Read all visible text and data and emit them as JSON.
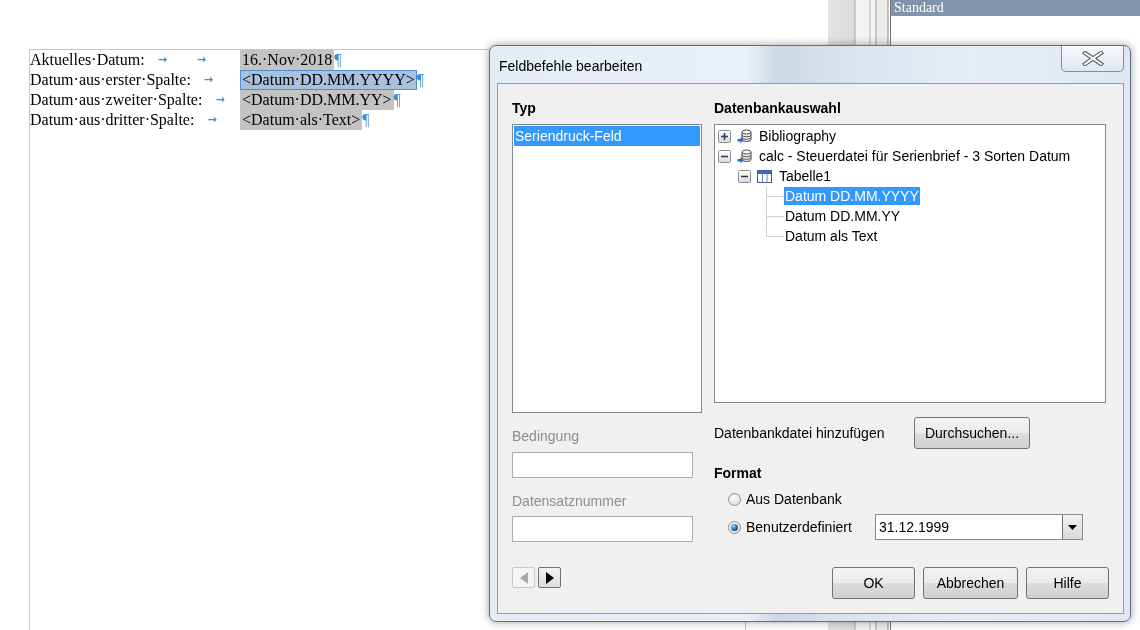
{
  "document": {
    "lines": [
      {
        "label": "Aktuelles·Datum:",
        "tab_marks": [
          "→",
          "→"
        ],
        "field": "16.·Nov·2018",
        "selected": false,
        "paragraph_mark": "¶"
      },
      {
        "label": "Datum·aus·erster·Spalte:",
        "tab_marks": [
          "→"
        ],
        "field": "<Datum·DD.MM.YYYY>",
        "selected": true,
        "paragraph_mark": "¶"
      },
      {
        "label": "Datum·aus·zweiter·Spalte:",
        "tab_marks": [
          "→"
        ],
        "field": "<Datum·DD.MM.YY>",
        "selected": false,
        "paragraph_mark": "¶"
      },
      {
        "label": "Datum·aus·dritter·Spalte:",
        "tab_marks": [
          "→"
        ],
        "field": "<Datum·als·Text>",
        "selected": false,
        "paragraph_mark": "¶"
      }
    ]
  },
  "sidebar": {
    "header": "Standard"
  },
  "dialog": {
    "title": "Feldbefehle bearbeiten",
    "type": {
      "heading": "Typ",
      "items": [
        {
          "label": "Seriendruck-Feld",
          "selected": true
        }
      ]
    },
    "condition": {
      "label": "Bedingung",
      "disabled": true
    },
    "record_number": {
      "label": "Datensatznummer",
      "disabled": true
    },
    "record_nav": [
      {
        "kind": "previous",
        "disabled": true
      },
      {
        "kind": "next",
        "disabled": false
      }
    ],
    "database_selection": {
      "heading": "Datenbankauswahl",
      "tree": [
        {
          "label": "Bibliography",
          "kind": "database",
          "expanded": false,
          "selected": false
        },
        {
          "label": "calc - Steuerdatei für Serienbrief - 3 Sorten Datum",
          "kind": "database",
          "expanded": true,
          "selected": false,
          "children": [
            {
              "label": "Tabelle1",
              "kind": "table",
              "expanded": true,
              "selected": false,
              "children": [
                {
                  "label": "Datum DD.MM.YYYY",
                  "kind": "column",
                  "selected": true
                },
                {
                  "label": "Datum DD.MM.YY",
                  "kind": "column",
                  "selected": false
                },
                {
                  "label": "Datum als Text",
                  "kind": "column",
                  "selected": false
                }
              ]
            }
          ]
        }
      ]
    },
    "add_database": {
      "label": "Datenbankdatei hinzufügen",
      "button": "Durchsuchen..."
    },
    "format": {
      "heading": "Format",
      "options": [
        {
          "label": "Aus Datenbank",
          "kind": "plain",
          "selected": false
        },
        {
          "label": "Benutzerdefiniert",
          "kind": "combo",
          "selected": true,
          "value": "31.12.1999"
        }
      ]
    },
    "buttons": [
      {
        "label": "OK"
      },
      {
        "label": "Abbrechen"
      },
      {
        "label": "Hilfe"
      }
    ]
  }
}
